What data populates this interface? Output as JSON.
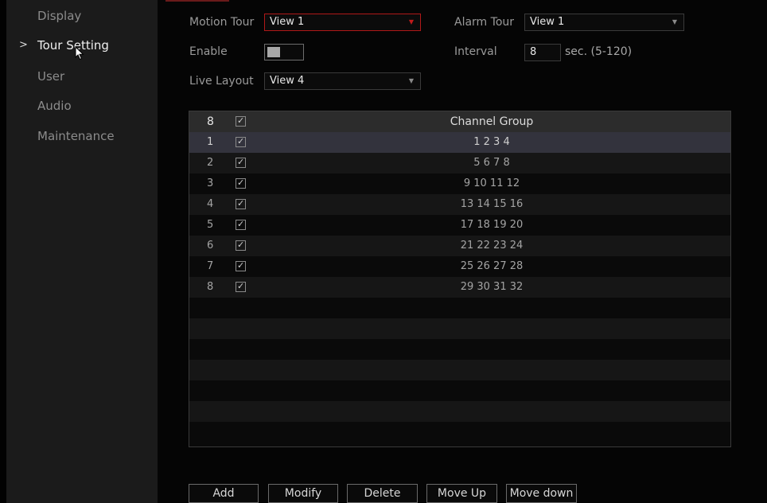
{
  "sidebar": {
    "items": [
      {
        "label": "Display"
      },
      {
        "label": "Tour Setting",
        "active": true
      },
      {
        "label": "User"
      },
      {
        "label": "Audio"
      },
      {
        "label": "Maintenance"
      }
    ],
    "active_marker": ">"
  },
  "form": {
    "motion_tour_label": "Motion Tour",
    "motion_tour_value": "View 1",
    "alarm_tour_label": "Alarm Tour",
    "alarm_tour_value": "View 1",
    "enable_label": "Enable",
    "enable_on": false,
    "interval_label": "Interval",
    "interval_value": "8",
    "interval_unit": "sec.  (5-120)",
    "live_layout_label": "Live Layout",
    "live_layout_value": "View 4"
  },
  "table": {
    "header": {
      "count": "8",
      "checked": true,
      "column": "Channel Group"
    },
    "rows": [
      {
        "index": "1",
        "checked": true,
        "group": "1  2  3  4"
      },
      {
        "index": "2",
        "checked": true,
        "group": "5  6  7  8"
      },
      {
        "index": "3",
        "checked": true,
        "group": "9 10 11 12"
      },
      {
        "index": "4",
        "checked": true,
        "group": "13 14 15 16"
      },
      {
        "index": "5",
        "checked": true,
        "group": "17 18 19 20"
      },
      {
        "index": "6",
        "checked": true,
        "group": "21 22 23 24"
      },
      {
        "index": "7",
        "checked": true,
        "group": "25 26 27 28"
      },
      {
        "index": "8",
        "checked": true,
        "group": "29 30 31 32"
      }
    ],
    "selected_row": 0
  },
  "buttons": {
    "add": "Add",
    "modify": "Modify",
    "delete": "Delete",
    "move_up": "Move Up",
    "move_down": "Move down"
  },
  "colors": {
    "accent_red": "#c21b1b",
    "sidebar_bg": "#1b1b1b",
    "selected_row": "#33333d"
  },
  "icons": {
    "checkbox": "check-icon",
    "dropdown": "dropdown-arrow-icon",
    "cursor": "mouse-pointer-icon"
  }
}
